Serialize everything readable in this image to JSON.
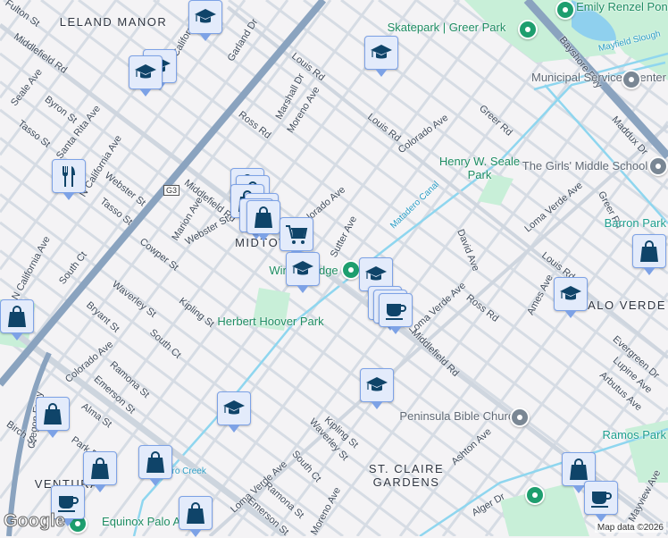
{
  "map": {
    "labels": [
      "LELAND MANOR",
      "Fulton St",
      "Middlefield Rd",
      "Seale Ave",
      "Byron St",
      "Santa Rita Ave",
      "Tasso St",
      "N California Ave",
      "Webster St",
      "Tasso St",
      "Garland Dr",
      "N California Ave",
      "Marshall Dr",
      "Moreno Ave",
      "Ross Rd",
      "Louis Rd",
      "Louis Rd",
      "Colorado Ave",
      "Greer Rd",
      "Maddux Dr",
      "Skatepark | Greer Park",
      "Bayshore Fwy",
      "Mayfield Slough",
      "Municipal Services Center",
      "Henry W. Seale Park",
      "The Girls' Middle School",
      "Matadero Canal",
      "Loma Verde Ave",
      "Greer Rd",
      "Barron Park",
      "David Ave",
      "Louis Rd",
      "Middlefield Rd",
      "Marion Ave",
      "Webster St",
      "MIDTOWN",
      "Sutter Ave",
      "Colorado Ave",
      "Winter Lodge",
      "Cowper St",
      "South Ct",
      "N California Ave",
      "Waverley St",
      "Kipling St",
      "Bryant St",
      "Herbert Hoover Park",
      "South Ct",
      "Colorado Ave",
      "Ramona St",
      "Emerson St",
      "Alma St",
      "Oregon Expy",
      "Park Blvd",
      "Birch St",
      "VENTURA",
      "Matadero Creek",
      "Equinox Palo Alto",
      "Loma Verde Ave",
      "South Ct",
      "Ramona St",
      "Emerson St",
      "Waverley St",
      "Kipling St",
      "Ross Rd",
      "Ames Ave",
      "Loma Verde Ave",
      "Middlefield Rd",
      "PALO VERDE",
      "Evergreen Dr",
      "Lupine Ave",
      "Arbutus Ave",
      "Peninsula Bible Church",
      "Ashton Ave",
      "ST. CLAIRE GARDENS",
      "Alger Dr",
      "Ramos Park",
      "Mayview Ave",
      "Emily Renzel Pond",
      "Moreno Ave"
    ],
    "highway_shield": "G3",
    "attribution": "Map data ©2026",
    "logo": "Google",
    "colors": {
      "marker_fill": "#e3ebfb",
      "marker_border": "#7da2e6",
      "icon": "#0f4469",
      "park": "#c8efd8",
      "water": "#8fd6ef",
      "freeway": "#8aa3bf",
      "road": "#d6dce4",
      "poi_green": "#1e9e6e",
      "poi_gray": "#7a8794"
    },
    "markers": [
      "school",
      "school",
      "school",
      "school",
      "restaurant",
      "shopping",
      "shopping",
      "shopping",
      "shopping",
      "shopping",
      "shopping",
      "shopping-cart",
      "school",
      "school",
      "coffee",
      "coffee",
      "coffee",
      "school",
      "school",
      "shopping",
      "school",
      "shopping",
      "shopping",
      "shopping",
      "coffee",
      "shopping",
      "shopping",
      "coffee",
      "shopping"
    ]
  }
}
